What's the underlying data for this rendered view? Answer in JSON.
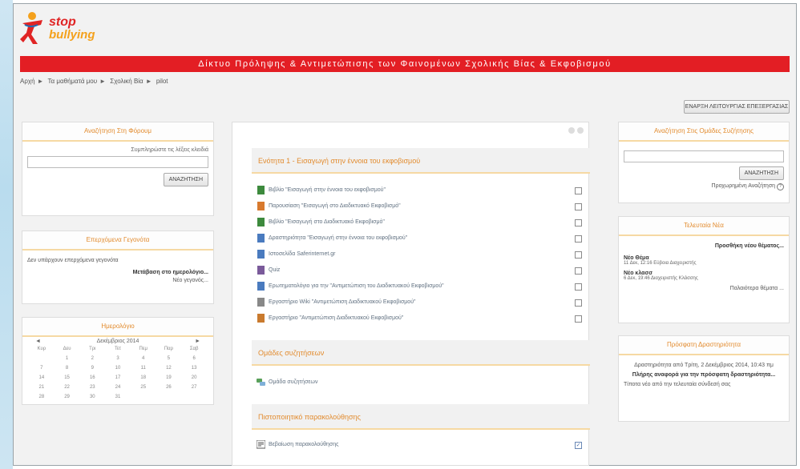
{
  "logo": {
    "line1": "stop",
    "line2": "bullying"
  },
  "banner": "Δίκτυο Πρόληψης & Αντιμετώπισης των Φαινομένων Σχολικής Βίας & Εκφοβισμού",
  "breadcrumb": [
    "Αρχή",
    "Τα μαθήματά μου",
    "Σχολική Βία",
    "pilot"
  ],
  "edit_button": "ΕΝΑΡΞΗ ΛΕΙΤΟΥΡΓΙΑΣ ΕΠΕΞΕΡΓΑΣΙΑΣ",
  "left": {
    "search": {
      "title": "Αναζήτηση Στη Φόρουμ",
      "label": "Συμπληρώστε τις λέξεις κλειδιά",
      "button": "ΑΝΑΖΗΤΗΣΗ"
    },
    "events": {
      "title": "Επερχόμενα Γεγονότα",
      "text": "Δεν υπάρχουν επερχόμενα γεγονότα",
      "link1": "Μετάβαση στο ημερολόγιο...",
      "link2": "Νέο γεγονός..."
    },
    "calendar": {
      "title": "Ημερολόγιο",
      "month": "Δεκέμβριος 2014",
      "prev": "◄",
      "next": "►",
      "days": [
        "Κυρ",
        "Δευ",
        "Τρι",
        "Τετ",
        "Πεμ",
        "Παρ",
        "Σαβ"
      ],
      "cells": [
        "",
        "1",
        "2",
        "3",
        "4",
        "5",
        "6",
        "7",
        "8",
        "9",
        "10",
        "11",
        "12",
        "13",
        "14",
        "15",
        "16",
        "17",
        "18",
        "19",
        "20",
        "21",
        "22",
        "23",
        "24",
        "25",
        "26",
        "27",
        "28",
        "29",
        "30",
        "31",
        "",
        "",
        ""
      ]
    }
  },
  "center": {
    "section1": "Ενότητα 1 - Εισαγωγή στην έννοια του εκφοβισμού",
    "activities": [
      {
        "label": "Βιβλίο \"Εισαγωγή στην έννοια του εκφοβισμού\"",
        "icon": "book-icon",
        "checked": false
      },
      {
        "label": "Παρουσίαση \"Εισαγωγή στο Διαδικτυακό Εκφοβισμό\"",
        "icon": "presentation-icon",
        "checked": false
      },
      {
        "label": "Βιβλίο \"Εισαγωγή στο Διαδικτυακό Εκφοβισμό\"",
        "icon": "book-icon",
        "checked": false
      },
      {
        "label": "Δραστηριότητα \"Εισαγωγή στην έννοια του εκφοβισμού\"",
        "icon": "activity-icon",
        "checked": false
      },
      {
        "label": "Ιστοσελίδα Saferinternet.gr",
        "icon": "link-icon",
        "checked": false
      },
      {
        "label": "Quiz",
        "icon": "quiz-icon",
        "checked": false
      },
      {
        "label": "Ερωτηματολόγιο για την \"Αντιμετώπιση του Διαδικτυακού Εκφοβισμού\"",
        "icon": "survey-icon",
        "checked": false
      },
      {
        "label": "Εργαστήριο Wiki \"Αντιμετώπιση Διαδικτυακού Εκφοβισμού\"",
        "icon": "wiki-icon",
        "checked": false
      },
      {
        "label": "Εργαστήριο \"Αντιμετώπιση Διαδικτυακού Εκφοβισμού\"",
        "icon": "workshop-icon",
        "checked": false
      }
    ],
    "section2": "Ομάδες συζητήσεων",
    "forum": "Ομάδα συζητήσεων",
    "section3": "Πιστοποιητικό παρακολούθησης",
    "certificate": {
      "label": "Βεβαίωση παρακολούθησης",
      "checked": true
    }
  },
  "right": {
    "search": {
      "title": "Αναζήτηση Στις Ομάδες Συζήτησης",
      "button": "ΑΝΑΖΗΤΗΣΗ",
      "advanced": "Προχωρημένη Αναζήτηση"
    },
    "news": {
      "title": "Τελευταία Νέα",
      "add": "Προσθήκη νέου θέματος...",
      "items": [
        {
          "title": "Νέο Θέμα",
          "meta": "11 Δεκ, 12:16 Εύβοια Διαχειριστής"
        },
        {
          "title": "Νέο κλασσ",
          "meta": "6 Δεκ, 19:46 Διαχειριστής Κλάσσης"
        }
      ],
      "older": "Παλαιότερα θέματα ..."
    },
    "recent": {
      "title": "Πρόσφατη Δραστηριότητα",
      "text": "Δραστηριότητα από Τρίτη, 2 Δεκέμβριος 2014, 10:43 πμ",
      "full": "Πλήρης αναφορά για την πρόσφατη δραστηριότητα...",
      "none": "Τίποτα νέο από την τελευταία σύνδεσή σας"
    }
  }
}
